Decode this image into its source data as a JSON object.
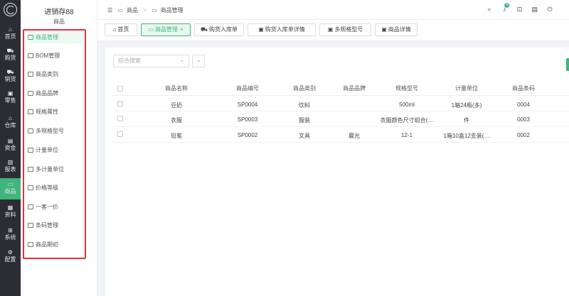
{
  "app": {
    "title": "进销存88",
    "section": "商品"
  },
  "rail": [
    {
      "label": "首页",
      "icon": "home-icon",
      "active": false
    },
    {
      "label": "购货",
      "icon": "cart-icon",
      "active": false
    },
    {
      "label": "销货",
      "icon": "sell-cart-icon",
      "active": false
    },
    {
      "label": "零售",
      "icon": "retail-icon",
      "active": false
    },
    {
      "label": "仓库",
      "icon": "warehouse-icon",
      "active": false
    },
    {
      "label": "资金",
      "icon": "wallet-icon",
      "active": false
    },
    {
      "label": "报表",
      "icon": "report-icon",
      "active": false
    },
    {
      "label": "商品",
      "icon": "box-icon",
      "active": true
    },
    {
      "label": "资料",
      "icon": "data-icon",
      "active": false
    },
    {
      "label": "系统",
      "icon": "system-icon",
      "active": false
    },
    {
      "label": "配置",
      "icon": "gear-icon",
      "active": false
    }
  ],
  "menu": [
    {
      "label": "商品管理",
      "icon": "box-icon",
      "active": true
    },
    {
      "label": "BOM管理",
      "icon": "document-icon",
      "active": false
    },
    {
      "label": "商品类别",
      "icon": "category-icon",
      "active": false
    },
    {
      "label": "商品品牌",
      "icon": "brand-icon",
      "active": false
    },
    {
      "label": "规格属性",
      "icon": "tag-icon",
      "active": false
    },
    {
      "label": "多规格型号",
      "icon": "layers-icon",
      "active": false
    },
    {
      "label": "计量单位",
      "icon": "scale-icon",
      "active": false
    },
    {
      "label": "多计量单位",
      "icon": "multi-scale-icon",
      "active": false
    },
    {
      "label": "价格等级",
      "icon": "price-level-icon",
      "active": false
    },
    {
      "label": "一客一价",
      "icon": "customer-price-icon",
      "active": false
    },
    {
      "label": "条码管理",
      "icon": "barcode-icon",
      "active": false
    },
    {
      "label": "商品期初",
      "icon": "cart-icon",
      "active": false
    }
  ],
  "breadcrumb": {
    "first": "商品",
    "separator": ">",
    "second": "商品管理"
  },
  "tabs": [
    {
      "label": "首页",
      "icon": "home-icon",
      "active": false
    },
    {
      "label": "商品管理",
      "icon": "box-icon",
      "active": true,
      "close": "×"
    },
    {
      "label": "购货入库单",
      "icon": "cart-icon",
      "active": false
    },
    {
      "label": "购货入库单详情",
      "icon": "document-icon",
      "active": false
    },
    {
      "label": "多规格型号",
      "icon": "layers-icon",
      "active": false
    },
    {
      "label": "商品详情",
      "icon": "document-icon",
      "active": false
    }
  ],
  "filter": {
    "placeholder": "综合搜索",
    "new_label": "新"
  },
  "table": {
    "columns": [
      "商品名称",
      "商品编号",
      "商品类别",
      "商品品牌",
      "规格型号",
      "计量单位",
      "商品条码"
    ],
    "rows": [
      [
        "豆奶",
        "SP0004",
        "饮料",
        "",
        "500ml",
        "1箱24瓶(多)",
        "0004"
      ],
      [
        "衣服",
        "SP0003",
        "服装",
        "",
        "衣服颜色尺寸组合(…",
        "件",
        "0003"
      ],
      [
        "铅笔",
        "SP0002",
        "文具",
        "晨光",
        "12-1",
        "1箱10盒12支装(…",
        "0002"
      ]
    ]
  },
  "colors": {
    "accent": "#3fb57b",
    "rail": "#2b2d33",
    "highlight_box": "#e8303a"
  }
}
